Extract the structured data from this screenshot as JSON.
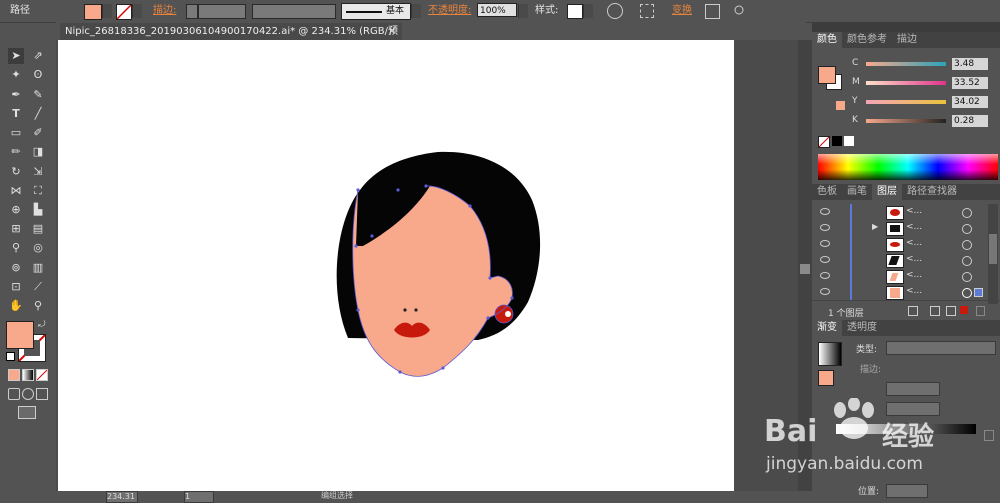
{
  "control_bar": {
    "selection_label": "路径",
    "fill_color": "#f8a98c",
    "stroke_label": "描边:",
    "stroke_profile_label": "基本",
    "opacity_label": "不透明度:",
    "opacity_value": "100%",
    "style_label": "样式:",
    "transform_label": "变换"
  },
  "document": {
    "tab_title": "Nipic_26818336_20190306104900170422.ai* @ 234.31% (RGB/预览)",
    "close_icon": "×"
  },
  "status_bar": {
    "zoom_value": "234.31",
    "page_value": "1",
    "status_text": "编组选择"
  },
  "color_panel": {
    "tabs": [
      "颜色",
      "颜色参考",
      "描边"
    ],
    "sliders": [
      {
        "label": "C",
        "value": "3.48",
        "color": "#2aa3b8"
      },
      {
        "label": "M",
        "value": "33.52",
        "color": "#e0348c"
      },
      {
        "label": "Y",
        "value": "34.02",
        "color": "#e8c23a"
      },
      {
        "label": "K",
        "value": "0.28",
        "color": "#222222"
      }
    ]
  },
  "layers_panel": {
    "tabs": [
      "色板",
      "画笔",
      "图层",
      "路径查找器"
    ],
    "active_tab": "图层",
    "rows": [
      {
        "name": "<..."
      },
      {
        "name": "<..."
      },
      {
        "name": "<..."
      },
      {
        "name": "<..."
      },
      {
        "name": "<..."
      },
      {
        "name": "<..."
      }
    ],
    "footer_text": "1 个图层"
  },
  "gradient_panel": {
    "tabs": [
      "渐变",
      "透明度"
    ],
    "type_label": "类型:",
    "stroke_label": "描边:",
    "position_label": "位置:"
  },
  "watermark": {
    "brand": "Bai",
    "brand_suffix": "经验",
    "url": "jingyan.baidu.com"
  },
  "colors": {
    "skin": "#f8a98c",
    "hair": "#050505",
    "lips": "#c81a0c",
    "earring": "#c81a0c",
    "path_blue": "#5b5bd6"
  }
}
